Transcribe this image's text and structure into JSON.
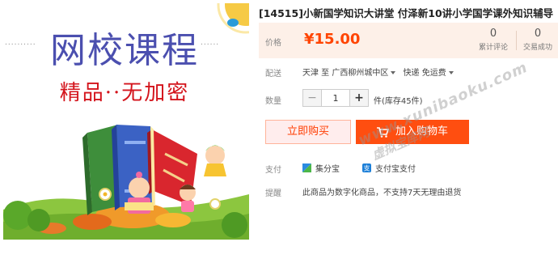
{
  "product": {
    "title": "[14515]小新国学知识大讲堂 付泽新10讲小学国学课外知识辅导",
    "image": {
      "headline": "网校课程",
      "subline": "精品··无加密",
      "dots": "..........",
      "dots_right": "......"
    }
  },
  "price": {
    "label": "价格",
    "value": "¥15.00"
  },
  "stats": [
    {
      "num": "0",
      "label": "累计评论"
    },
    {
      "num": "0",
      "label": "交易成功"
    }
  ],
  "delivery": {
    "label": "配送",
    "origin": "天津 至",
    "destination": "广西柳州城中区",
    "shipping": "快递 免运费"
  },
  "quantity": {
    "label": "数量",
    "value": "1",
    "minus": "−",
    "plus": "+",
    "stock": "件(库存45件)"
  },
  "actions": {
    "buy_now": "立即购买",
    "add_to_cart": "加入购物车"
  },
  "payment": {
    "label": "支付",
    "options": [
      "集分宝",
      "支付宝支付"
    ]
  },
  "notice": {
    "label": "提醒",
    "text": "此商品为数字化商品，不支持7天无理由退货"
  },
  "watermark": {
    "url": "www.xunibaoku.com",
    "cn": "虚拟宝库网"
  },
  "colors": {
    "accent": "#ff4400",
    "cart_button": "#ff4e10",
    "price_bg": "#fdf0e8",
    "headline": "#4b4faf",
    "subline": "#d4141c"
  }
}
